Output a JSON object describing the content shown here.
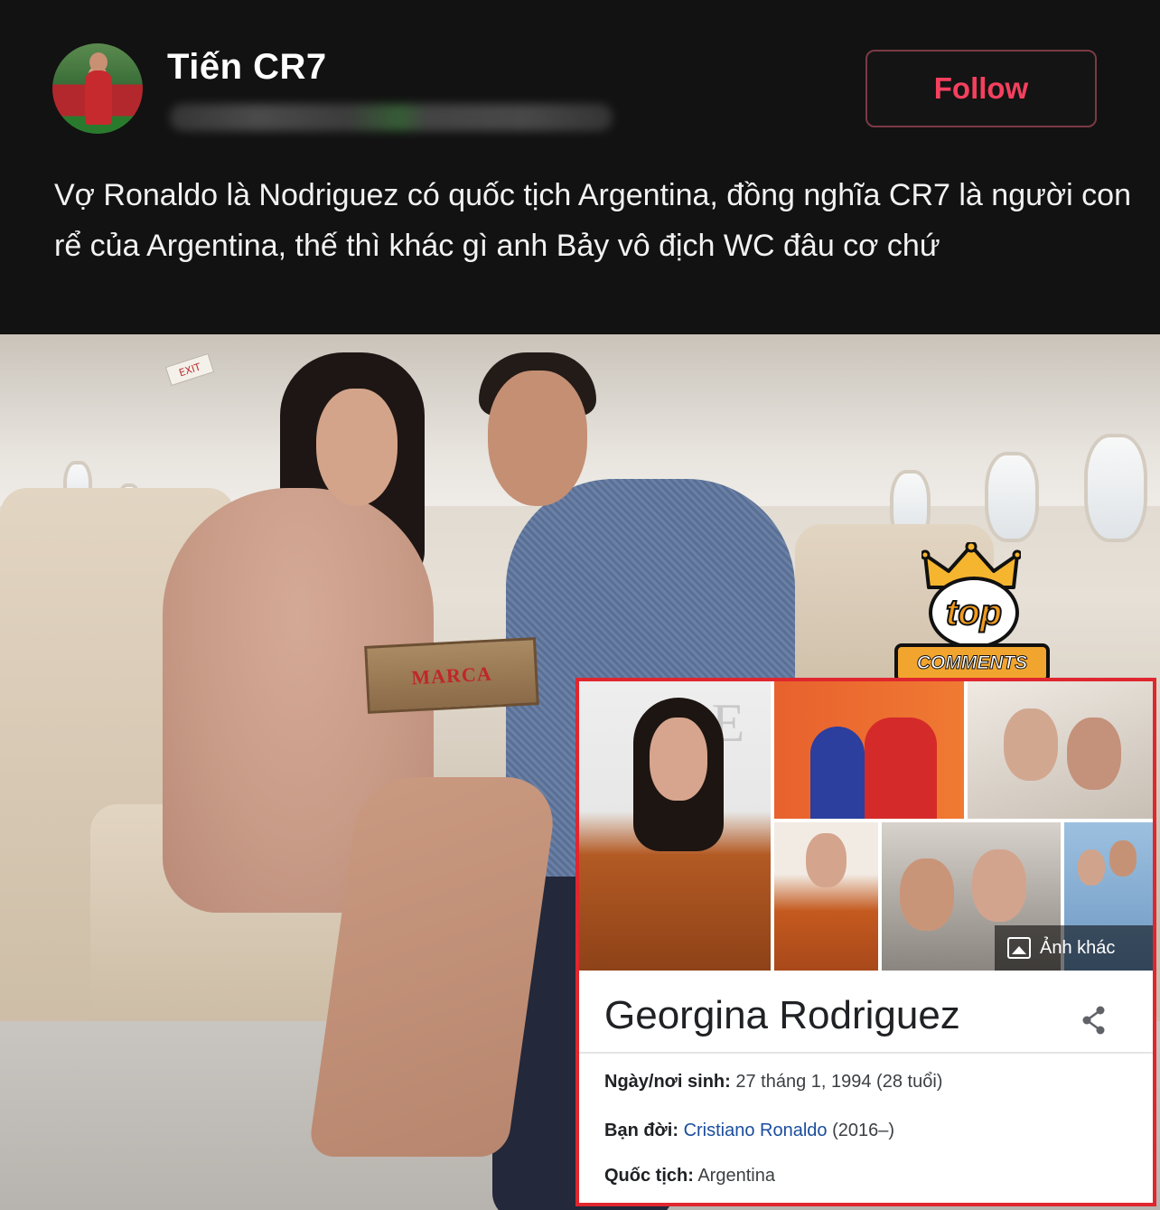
{
  "post": {
    "username": "Tiến CR7",
    "follow_label": "Follow",
    "text": "Vợ Ronaldo là Nodriguez có quốc tịch Argentina, đồng nghĩa CR7 là người con rể của Argentina, thế thì khác gì anh Bảy vô địch WC đâu cơ chứ"
  },
  "photo": {
    "box_label": "MARCA",
    "exit_label": "EXIT"
  },
  "badge": {
    "top": "top",
    "comments": "COMMENTS"
  },
  "knowledge_panel": {
    "more_images_label": "Ảnh khác",
    "name": "Georgina Rodriguez",
    "facts": [
      {
        "label": "Ngày/nơi sinh:",
        "value": "27 tháng 1, 1994 (28 tuổi)"
      },
      {
        "label": "Bạn đời:",
        "value": "Cristiano Ronaldo",
        "extra": "(2016–)"
      },
      {
        "label": "Quốc tịch:",
        "value": "Argentina"
      }
    ]
  },
  "colors": {
    "follow_text": "#f5405e",
    "panel_border": "#e0262e",
    "link": "#1a4d9c"
  }
}
